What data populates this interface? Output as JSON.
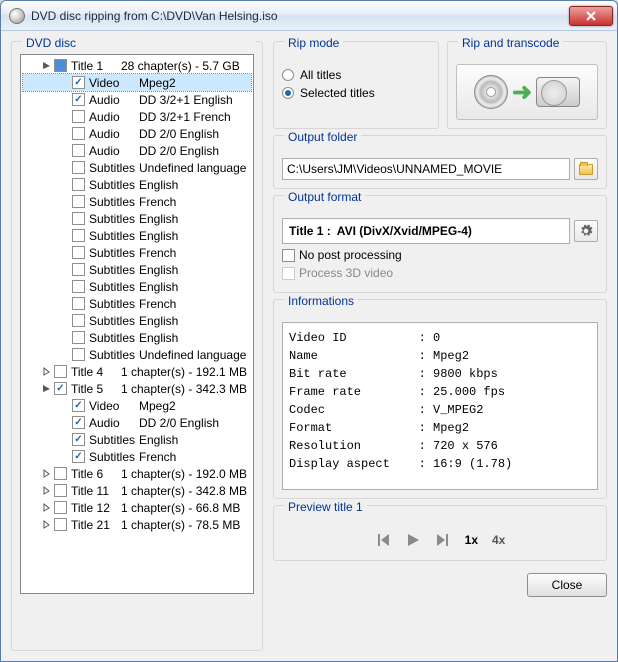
{
  "window": {
    "title": "DVD disc ripping from C:\\DVD\\Van Helsing.iso"
  },
  "tree": {
    "header": "DVD disc",
    "rows": [
      {
        "lvl": 1,
        "tog": "open",
        "chk": "mixed",
        "type": "Title 1",
        "desc": "28 chapter(s) - 5.7 GB"
      },
      {
        "lvl": 2,
        "chk": "on",
        "type": "Video",
        "desc": "Mpeg2",
        "sel": true
      },
      {
        "lvl": 2,
        "chk": "on",
        "type": "Audio",
        "desc": "DD 3/2+1 English"
      },
      {
        "lvl": 2,
        "chk": "off",
        "type": "Audio",
        "desc": "DD 3/2+1 French"
      },
      {
        "lvl": 2,
        "chk": "off",
        "type": "Audio",
        "desc": "DD 2/0 English"
      },
      {
        "lvl": 2,
        "chk": "off",
        "type": "Audio",
        "desc": "DD 2/0 English"
      },
      {
        "lvl": 2,
        "chk": "off",
        "type": "Subtitles",
        "desc": "Undefined language"
      },
      {
        "lvl": 2,
        "chk": "off",
        "type": "Subtitles",
        "desc": "English"
      },
      {
        "lvl": 2,
        "chk": "off",
        "type": "Subtitles",
        "desc": "French"
      },
      {
        "lvl": 2,
        "chk": "off",
        "type": "Subtitles",
        "desc": "English"
      },
      {
        "lvl": 2,
        "chk": "off",
        "type": "Subtitles",
        "desc": "English"
      },
      {
        "lvl": 2,
        "chk": "off",
        "type": "Subtitles",
        "desc": "French"
      },
      {
        "lvl": 2,
        "chk": "off",
        "type": "Subtitles",
        "desc": "English"
      },
      {
        "lvl": 2,
        "chk": "off",
        "type": "Subtitles",
        "desc": "English"
      },
      {
        "lvl": 2,
        "chk": "off",
        "type": "Subtitles",
        "desc": "French"
      },
      {
        "lvl": 2,
        "chk": "off",
        "type": "Subtitles",
        "desc": "English"
      },
      {
        "lvl": 2,
        "chk": "off",
        "type": "Subtitles",
        "desc": "English"
      },
      {
        "lvl": 2,
        "chk": "off",
        "type": "Subtitles",
        "desc": "Undefined language"
      },
      {
        "lvl": 1,
        "tog": "closed",
        "chk": "off",
        "type": "Title 4",
        "desc": "1 chapter(s) - 192.1 MB"
      },
      {
        "lvl": 1,
        "tog": "open",
        "chk": "on",
        "type": "Title 5",
        "desc": "1 chapter(s) - 342.3 MB"
      },
      {
        "lvl": 2,
        "chk": "on",
        "type": "Video",
        "desc": "Mpeg2"
      },
      {
        "lvl": 2,
        "chk": "on",
        "type": "Audio",
        "desc": "DD 2/0 English"
      },
      {
        "lvl": 2,
        "chk": "on",
        "type": "Subtitles",
        "desc": "English"
      },
      {
        "lvl": 2,
        "chk": "on",
        "type": "Subtitles",
        "desc": "French"
      },
      {
        "lvl": 1,
        "tog": "closed",
        "chk": "off",
        "type": "Title 6",
        "desc": "1 chapter(s) - 192.0 MB"
      },
      {
        "lvl": 1,
        "tog": "closed",
        "chk": "off",
        "type": "Title 11",
        "desc": "1 chapter(s) - 342.8 MB"
      },
      {
        "lvl": 1,
        "tog": "closed",
        "chk": "off",
        "type": "Title 12",
        "desc": "1 chapter(s) - 66.8 MB"
      },
      {
        "lvl": 1,
        "tog": "closed",
        "chk": "off",
        "type": "Title 21",
        "desc": "1 chapter(s) - 78.5 MB"
      }
    ]
  },
  "ripMode": {
    "label": "Rip mode",
    "all": "All titles",
    "selected": "Selected titles"
  },
  "ripTranscode": {
    "label": "Rip and transcode"
  },
  "outputFolder": {
    "label": "Output folder",
    "value": "C:\\Users\\JM\\Videos\\UNNAMED_MOVIE"
  },
  "outputFormat": {
    "label": "Output format",
    "titleLabel": "Title 1 :",
    "formatValue": "AVI (DivX/Xvid/MPEG-4)",
    "noPost": "No post processing",
    "process3d": "Process 3D video"
  },
  "info": {
    "label": "Informations",
    "text": "Video ID          : 0\nName              : Mpeg2\nBit rate          : 9800 kbps\nFrame rate        : 25.000 fps\nCodec             : V_MPEG2\nFormat            : Mpeg2\nResolution        : 720 x 576\nDisplay aspect    : 16:9 (1.78)"
  },
  "preview": {
    "label": "Preview title 1",
    "speed1": "1x",
    "speed4": "4x"
  },
  "footer": {
    "close": "Close"
  }
}
